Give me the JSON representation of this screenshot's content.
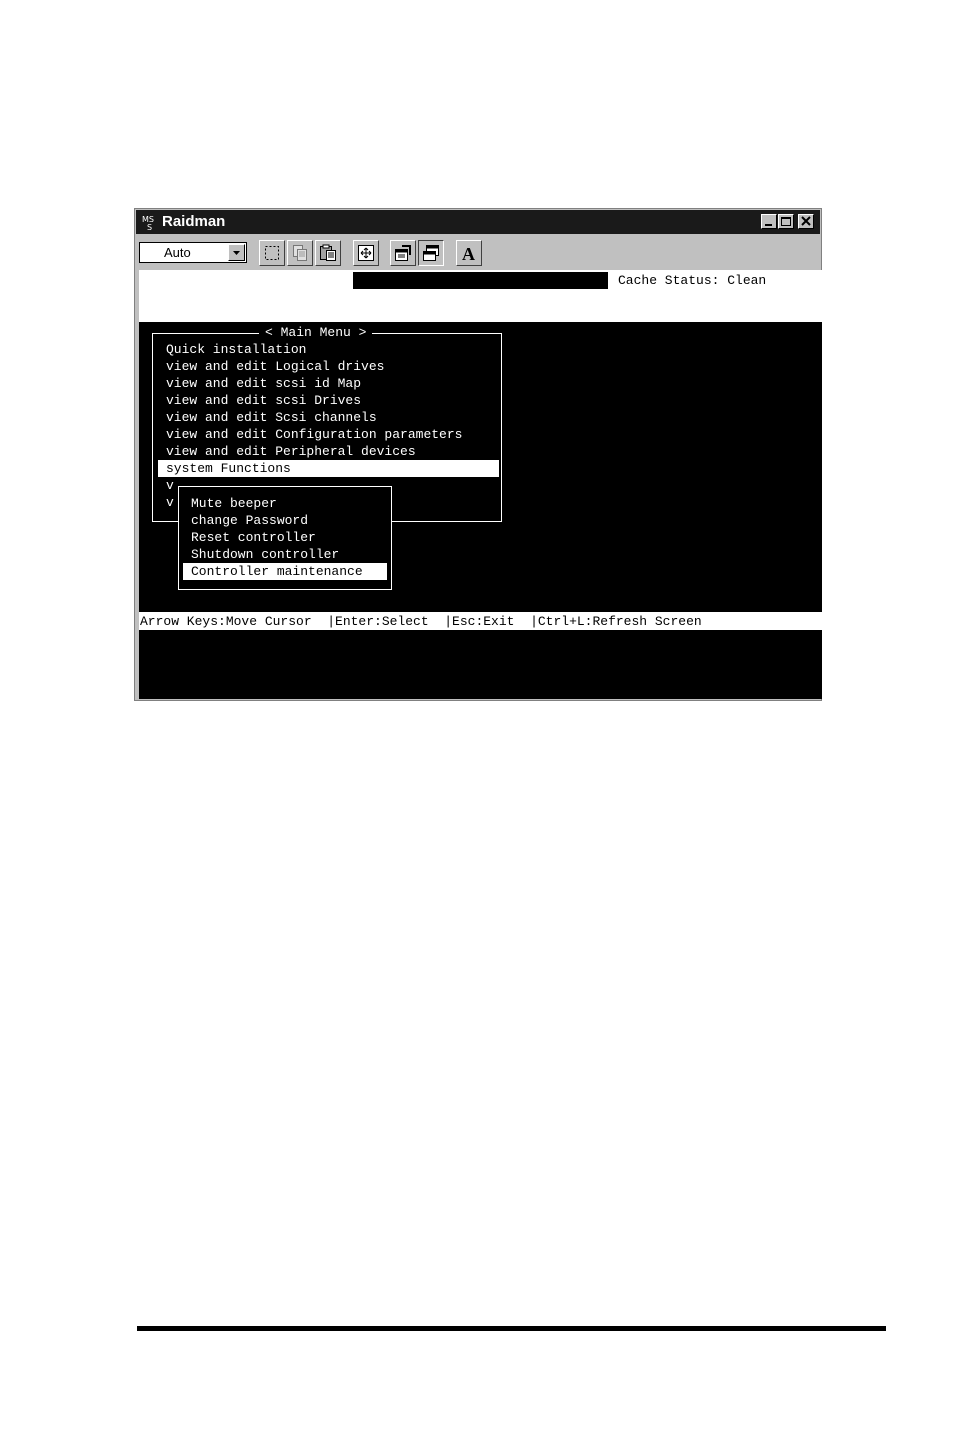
{
  "window": {
    "title": "Raidman"
  },
  "toolbar": {
    "font_size_value": "Auto",
    "buttons": [
      {
        "icon": "mark-icon"
      },
      {
        "icon": "copy-icon"
      },
      {
        "icon": "paste-icon"
      },
      {
        "icon": "fullscreen-icon"
      },
      {
        "icon": "properties-icon"
      },
      {
        "icon": "background-icon"
      },
      {
        "icon": "font-icon",
        "label": "A"
      }
    ]
  },
  "terminal": {
    "cache_status": "Cache Status: Clean",
    "main_menu": {
      "title": "< Main Menu >",
      "items": [
        "Quick installation",
        "view and edit Logical drives",
        "view and edit scsi id Map",
        "view and edit scsi Drives",
        "view and edit Scsi channels",
        "view and edit Configuration parameters",
        "view and edit Peripheral devices",
        "system Functions",
        "v",
        "v"
      ],
      "selected": "system Functions"
    },
    "submenu": {
      "items": [
        "Mute beeper",
        "change Password",
        "Reset controller",
        "Shutdown controller",
        "Controller maintenance"
      ],
      "selected": "Controller maintenance"
    },
    "status_bar": "Arrow Keys:Move Cursor  |Enter:Select  |Esc:Exit  |Ctrl+L:Refresh Screen"
  },
  "colors": {
    "terminal_bg": "#000000",
    "terminal_fg": "#ffffff",
    "window_chrome": "#c0c0c0",
    "titlebar": "#1a1a1a"
  }
}
